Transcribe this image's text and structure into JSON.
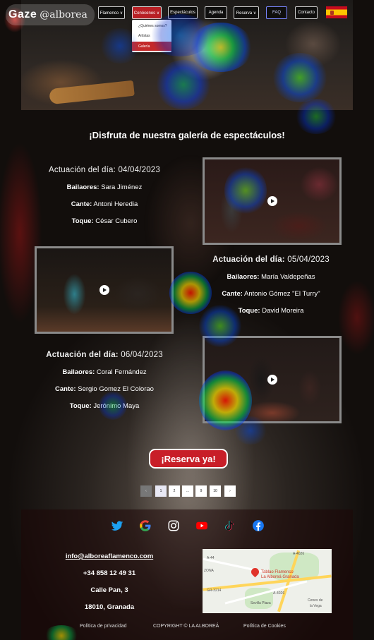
{
  "brand": {
    "logo_word": "Gaze",
    "logo_site": "@alborea",
    "colors": {
      "accent": "#c81e28",
      "nav_border": "#cfcfcf",
      "faq_border": "#7a86ff"
    }
  },
  "nav": {
    "items": [
      {
        "label": "Flamenco ∨"
      },
      {
        "label": "Conócenos ∨"
      },
      {
        "label": "Espectáculos"
      },
      {
        "label": "Agenda"
      },
      {
        "label": "Reserva ∨"
      },
      {
        "label": "FAQ"
      },
      {
        "label": "Contacto"
      }
    ],
    "language_flag": "spain-flag-icon",
    "dropdown": {
      "items": [
        {
          "label": "¿Quiénes somos?"
        },
        {
          "label": "Artistas"
        },
        {
          "label": "Galería"
        }
      ]
    }
  },
  "gallery": {
    "title": "¡Disfruta de nuestra galería de espectáculos!",
    "events": [
      {
        "date_label": "Actuación del día:",
        "date": "04/04/2023",
        "dancers_label": "Bailaores:",
        "dancers": "Sara Jiménez",
        "singer_label": "Cante:",
        "singer": "Antoni Heredia",
        "guitar_label": "Toque:",
        "guitar": "César Cubero"
      },
      {
        "date_label": "Actuación del día:",
        "date": "05/04/2023",
        "dancers_label": "Bailaores:",
        "dancers": "María Valdepeñas",
        "singer_label": "Cante:",
        "singer": "Antonio Gómez \"El Turry\"",
        "guitar_label": "Toque:",
        "guitar": "David Moreira"
      },
      {
        "date_label": "Actuación del día:",
        "date": "06/04/2023",
        "dancers_label": "Bailaores:",
        "dancers": "Coral Fernández",
        "singer_label": "Cante:",
        "singer": "Sergio Gomez El Colorao",
        "guitar_label": "Toque:",
        "guitar": "Jerónimo Maya"
      }
    ]
  },
  "reserve_button": "¡Reserva ya!",
  "pagination": {
    "prev": "‹",
    "pages": [
      "1",
      "2",
      "...",
      "9",
      "10"
    ],
    "next": "›"
  },
  "footer": {
    "socials": [
      "twitter-icon",
      "google-icon",
      "instagram-icon",
      "youtube-icon",
      "tiktok-icon",
      "facebook-icon"
    ],
    "email": "info@alboreaflamenco.com",
    "phone": "+34 858 12 49 31",
    "address": "Calle Pan, 3",
    "city": "18010, Granada",
    "map": {
      "place_line1": "Tablao Flamenco",
      "place_line2": "La Alboreá Granada",
      "labels": [
        "A-4026",
        "A-44",
        "ZONA",
        "GR-3214",
        "Sevilla Plaza",
        "Cenes de",
        "la Vega",
        "A-4026"
      ]
    },
    "legal": {
      "privacy": "Política de privacidad",
      "copyright": "COPYRIGHT © LA ALBOREÁ",
      "cookies": "Política de Cookies"
    }
  }
}
